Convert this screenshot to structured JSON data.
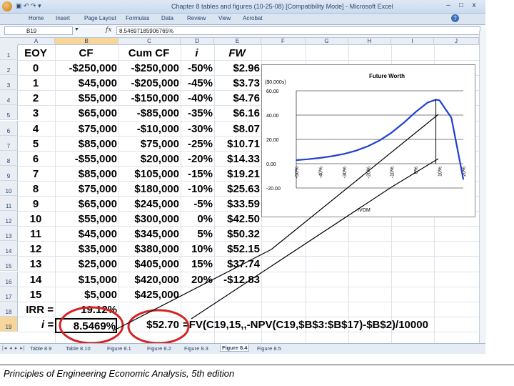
{
  "window": {
    "title": "Chapter 8 tables and figures (10-25-08) [Compatibility Mode] - Microsoft Excel",
    "qat": "▣ ↶ ↷ ▾",
    "controls": {
      "minimize": "–",
      "maximize": "□",
      "close": "x"
    }
  },
  "ribbon": {
    "tabs": [
      "Home",
      "Insert",
      "Page Layout",
      "Formulas",
      "Data",
      "Review",
      "View",
      "Acrobat"
    ],
    "help": "?"
  },
  "formula_bar": {
    "name_box": "B19",
    "fx": "fx",
    "formula": "8.54697185906765%"
  },
  "columns": [
    "A",
    "B",
    "C",
    "D",
    "E",
    "F",
    "G",
    "H",
    "I",
    "J"
  ],
  "rows": [
    "1",
    "2",
    "3",
    "4",
    "5",
    "6",
    "7",
    "8",
    "9",
    "10",
    "11",
    "12",
    "13",
    "14",
    "15",
    "16",
    "17",
    "18",
    "19"
  ],
  "headers": {
    "eoy": "EOY",
    "cf": "CF",
    "cum_cf": "Cum CF",
    "i": "i",
    "fw": "FW"
  },
  "table": {
    "eoy": [
      "0",
      "1",
      "2",
      "3",
      "4",
      "5",
      "6",
      "7",
      "8",
      "9",
      "10",
      "11",
      "12",
      "13",
      "14",
      "15"
    ],
    "cf": [
      "-$250,000",
      "$45,000",
      "$55,000",
      "$65,000",
      "$75,000",
      "$85,000",
      "-$55,000",
      "$85,000",
      "$75,000",
      "$65,000",
      "$55,000",
      "$45,000",
      "$35,000",
      "$25,000",
      "$15,000",
      "$5,000"
    ],
    "cum_cf": [
      "-$250,000",
      "-$205,000",
      "-$150,000",
      "-$85,000",
      "-$10,000",
      "$75,000",
      "$20,000",
      "$105,000",
      "$180,000",
      "$245,000",
      "$300,000",
      "$345,000",
      "$380,000",
      "$405,000",
      "$420,000",
      "$425,000"
    ],
    "i": [
      "-50%",
      "-45%",
      "-40%",
      "-35%",
      "-30%",
      "-25%",
      "-20%",
      "-15%",
      "-10%",
      "-5%",
      "0%",
      "5%",
      "10%",
      "15%",
      "20%"
    ],
    "fw": [
      "$2.96",
      "$3.73",
      "$4.76",
      "$6.16",
      "$8.07",
      "$10.71",
      "$14.33",
      "$19.21",
      "$25.63",
      "$33.59",
      "$42.50",
      "$50.32",
      "$52.15",
      "$37.74",
      "-$12.83"
    ]
  },
  "irr_row": {
    "label": "IRR =",
    "value": "19.12%"
  },
  "i_row": {
    "label": "i =",
    "value": "8.5469%",
    "fw_value": "$52.70",
    "formula": "=FV(C19,15,,-NPV(C19,$B$3:$B$17)-$B$2)/10000"
  },
  "sheet_tabs": [
    "Table 8.9",
    "Table 8.10",
    "Figure 8.1",
    "Figure 8.2",
    "Figure 8.3",
    "Figure 8.4",
    "Figure 8.5"
  ],
  "active_sheet": "Figure 8.4",
  "tab_nav": "|◂ ◂ ▸ ▸|",
  "chart_data": {
    "type": "line",
    "title": "Future Worth",
    "ylabel": "($0,000s)",
    "xlabel": "IVOM",
    "yticks": [
      "60.00",
      "40.00",
      "20.00",
      "0.00",
      "-20.00"
    ],
    "ylim": [
      -20,
      60
    ],
    "xticks": [
      "-50%",
      "-40%",
      "-30%",
      "-20%",
      "-10%",
      "0%",
      "10%",
      "20%"
    ],
    "xlim": [
      -0.5,
      0.2
    ],
    "series": [
      {
        "x": [
          -0.5,
          -0.45,
          -0.4,
          -0.35,
          -0.3,
          -0.25,
          -0.2,
          -0.15,
          -0.1,
          -0.05,
          0,
          0.05,
          0.085,
          0.1,
          0.15,
          0.2
        ],
        "y": [
          2.96,
          3.73,
          4.76,
          6.16,
          8.07,
          10.71,
          14.33,
          19.21,
          25.63,
          33.59,
          42.5,
          50.32,
          52.7,
          52.15,
          37.74,
          -12.83
        ]
      }
    ],
    "line_color": "#1f3fd1",
    "grid": true
  },
  "annotation_color": "#d62222",
  "footer": "Principles of Engineering Economic Analysis, 5th edition"
}
